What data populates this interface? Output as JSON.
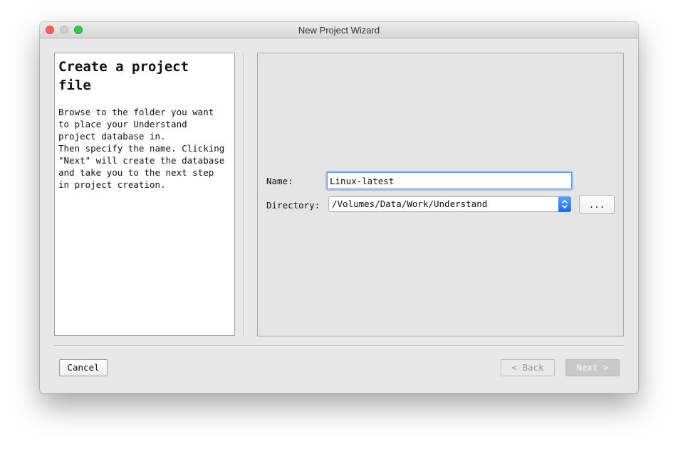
{
  "window": {
    "title": "New Project Wizard"
  },
  "left_panel": {
    "heading": "Create a project\nfile",
    "description": "Browse to the folder you want\nto place your Understand\nproject database in.\nThen specify the name. Clicking\n\"Next\" will create the database\nand take you to the next step\nin project creation."
  },
  "form": {
    "name_label": "Name:",
    "name_value": "Linux-latest",
    "directory_label": "Directory:",
    "directory_value": "/Volumes/Data/Work/Understand",
    "browse_label": "..."
  },
  "footer": {
    "cancel_label": "Cancel",
    "back_label": "< Back",
    "next_label": "Next >"
  },
  "colors": {
    "close": "#fc605c",
    "minimize_inactive": "#cfcfcf",
    "zoom": "#34c84a",
    "focus_ring": "#6a9ad8",
    "dropdown_accent": "#1a6cf0"
  },
  "icons": {
    "dropdown": "chevron-updown-icon"
  }
}
